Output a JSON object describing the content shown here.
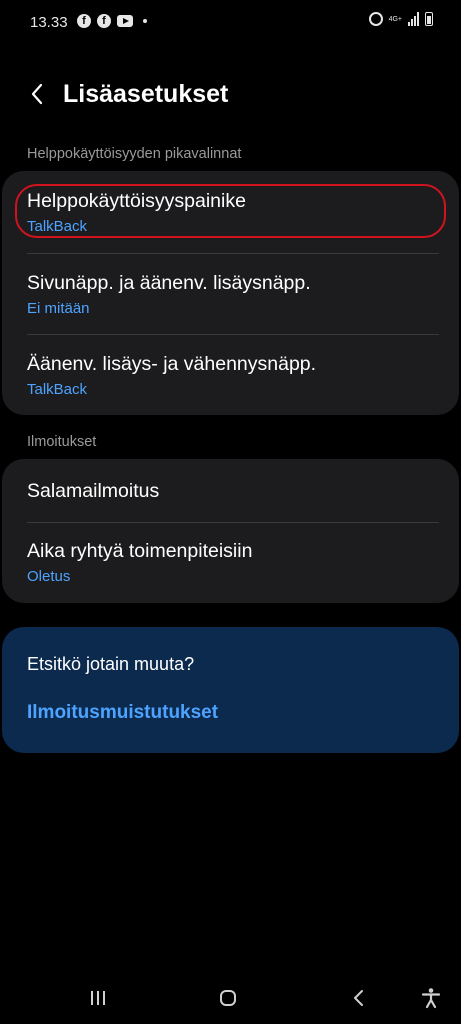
{
  "status_bar": {
    "time": "13.33",
    "network": "4G+"
  },
  "header": {
    "title": "Lisäasetukset"
  },
  "sections": [
    {
      "label": "Helppokäyttöisyyden pikavalinnat",
      "items": [
        {
          "title": "Helppokäyttöisyyspainike",
          "subtitle": "TalkBack"
        },
        {
          "title": "Sivunäpp. ja äänenv. lisäysnäpp.",
          "subtitle": "Ei mitään"
        },
        {
          "title": "Äänenv. lisäys- ja vähennysnäpp.",
          "subtitle": "TalkBack"
        }
      ]
    },
    {
      "label": "Ilmoitukset",
      "items": [
        {
          "title": "Salamailmoitus"
        },
        {
          "title": "Aika ryhtyä toimenpiteisiin",
          "subtitle": "Oletus"
        }
      ]
    }
  ],
  "suggestion": {
    "title": "Etsitkö jotain muuta?",
    "link": "Ilmoitusmuistutukset"
  },
  "colors": {
    "accent": "#4da3ff",
    "card": "#1c1c1e",
    "suggest_card": "#0b2a4e",
    "highlight": "#d0131e"
  }
}
